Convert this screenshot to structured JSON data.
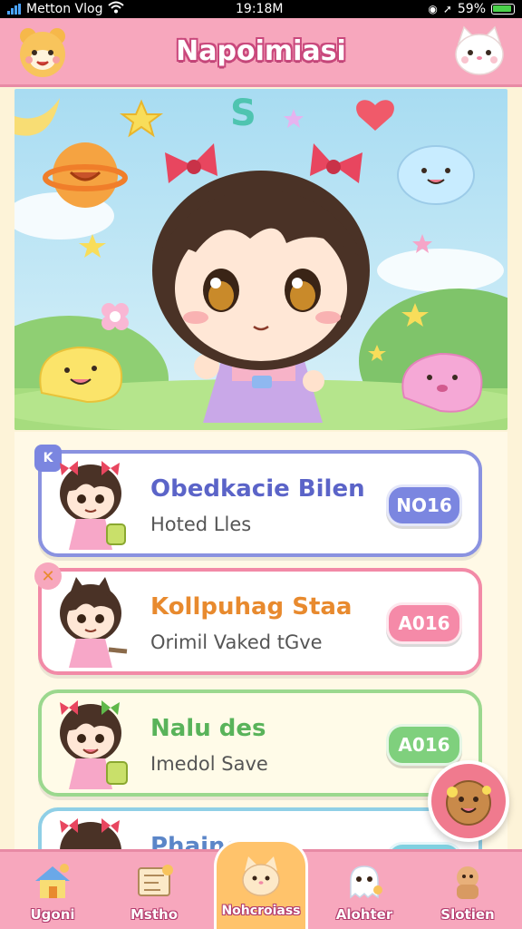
{
  "status_bar": {
    "carrier": "Metton Vlog",
    "time": "19:18M",
    "battery": "59%"
  },
  "header": {
    "title": "Napoimiasi"
  },
  "cards": [
    {
      "title": "Obedkacie Bilen",
      "subtitle": "Hoted Lles",
      "button": "NO16",
      "badge": "K"
    },
    {
      "title": "Kollpuhag Staa",
      "subtitle": "Orimil Vaked tGve",
      "button": "A016",
      "badge": "✕"
    },
    {
      "title": "Nalu des",
      "subtitle": "Imedol Save",
      "button": "A016"
    },
    {
      "title": "Phaines",
      "subtitle": "",
      "button": ""
    }
  ],
  "bottom_nav": [
    {
      "label": "Ugoni",
      "icon": "house-icon"
    },
    {
      "label": "Mstho",
      "icon": "map-icon"
    },
    {
      "label": "Nohcroiass",
      "icon": "cat-face-icon"
    },
    {
      "label": "Alohter",
      "icon": "ghost-icon"
    },
    {
      "label": "Slotien",
      "icon": "character-icon"
    }
  ],
  "colors": {
    "header": "#f7a7bd",
    "card_blue": "#8a92e0",
    "card_pink": "#f28aa7",
    "card_green": "#9bd88e",
    "accent_orange": "#ffc36b"
  }
}
